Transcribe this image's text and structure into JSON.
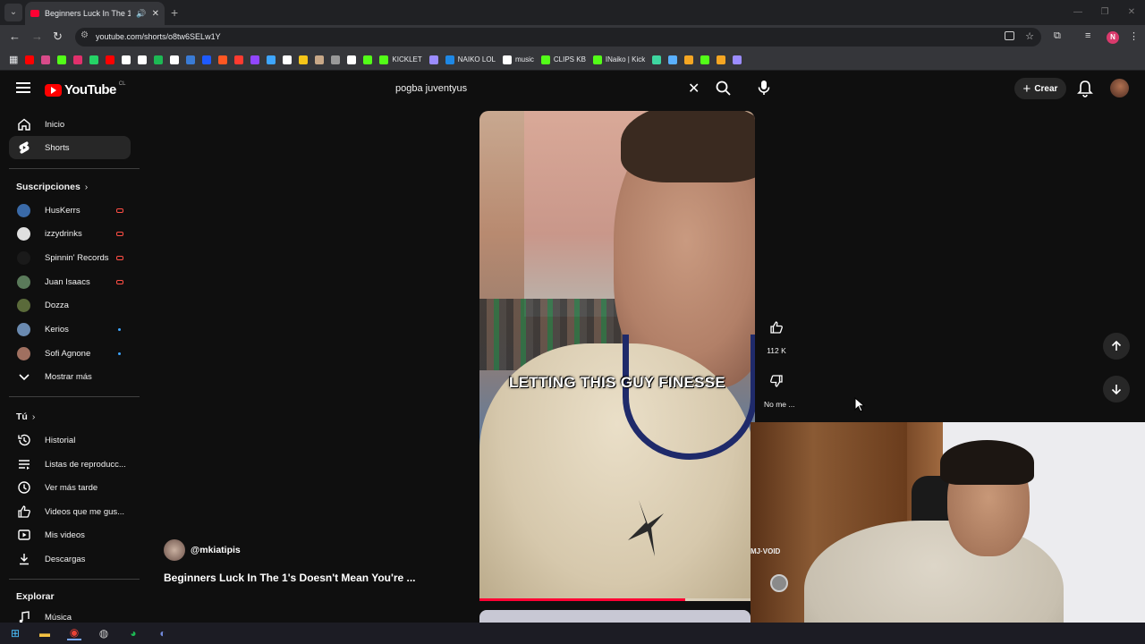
{
  "browser": {
    "tab_title": "Beginners Luck In The 1's Doesn't Mean You're",
    "url": "youtube.com/shorts/o8tw6SELw1Y",
    "profile_initial": "N",
    "bookmarks": [
      {
        "label": "",
        "color": "#ff0000"
      },
      {
        "label": "",
        "color": "#d84b8a"
      },
      {
        "label": "",
        "color": "#53fc18"
      },
      {
        "label": "",
        "color": "#e1306c"
      },
      {
        "label": "",
        "color": "#25d366"
      },
      {
        "label": "",
        "color": "#ff0000"
      },
      {
        "label": "",
        "color": "#ffffff"
      },
      {
        "label": "",
        "color": "#ffffff"
      },
      {
        "label": "",
        "color": "#1db954"
      },
      {
        "label": "",
        "color": "#ffffff"
      },
      {
        "label": "",
        "color": "#3a7bd5"
      },
      {
        "label": "",
        "color": "#1e5aff"
      },
      {
        "label": "",
        "color": "#ff5722"
      },
      {
        "label": "",
        "color": "#ff3b30"
      },
      {
        "label": "",
        "color": "#9146ff"
      },
      {
        "label": "",
        "color": "#3ea6ff"
      },
      {
        "label": "",
        "color": "#ffffff"
      },
      {
        "label": "",
        "color": "#f5c518"
      },
      {
        "label": "",
        "color": "#c8a888"
      },
      {
        "label": "",
        "color": "#999999"
      },
      {
        "label": "",
        "color": "#ffffff"
      },
      {
        "label": "",
        "color": "#53fc18"
      },
      {
        "label": "KICKLET",
        "color": "#53fc18"
      },
      {
        "label": "",
        "color": "#9b8cff"
      },
      {
        "label": "NAIKO LOL",
        "color": "#1e88e5"
      },
      {
        "label": "music",
        "color": "#ffffff"
      },
      {
        "label": "CLIPS KB",
        "color": "#53fc18"
      },
      {
        "label": "INaiko | Kick",
        "color": "#53fc18"
      },
      {
        "label": "",
        "color": "#3ed6a0"
      },
      {
        "label": "",
        "color": "#5ab0ff"
      },
      {
        "label": "",
        "color": "#f5a623"
      },
      {
        "label": "",
        "color": "#53fc18"
      },
      {
        "label": "",
        "color": "#f5a623"
      },
      {
        "label": "",
        "color": "#9b8cff"
      }
    ]
  },
  "youtube": {
    "logo_text": "YouTube",
    "region": "CL",
    "search_query": "pogba juventyus",
    "create_label": "Crear",
    "sidebar": {
      "main": [
        {
          "label": "Inicio",
          "icon": "home-icon"
        },
        {
          "label": "Shorts",
          "icon": "shorts-icon",
          "active": true
        }
      ],
      "subs_header": "Suscripciones",
      "subscriptions": [
        {
          "label": "HusKerrs",
          "status": "live",
          "color": "#3a6aa8"
        },
        {
          "label": "izzydrinks",
          "status": "live",
          "color": "#e0e0e0"
        },
        {
          "label": "Spinnin' Records",
          "status": "live",
          "color": "#1a1a1a"
        },
        {
          "label": "Juan Isaacs",
          "status": "live",
          "color": "#5a7a5a"
        },
        {
          "label": "Dozza",
          "status": "",
          "color": "#5a6a3a"
        },
        {
          "label": "Kerios",
          "status": "new",
          "color": "#6a8ab0"
        },
        {
          "label": "Sofi Agnone",
          "status": "new",
          "color": "#a07060"
        }
      ],
      "show_more": "Mostrar más",
      "you_header": "Tú",
      "you_items": [
        {
          "label": "Historial",
          "icon": "history-icon"
        },
        {
          "label": "Listas de reproducc...",
          "icon": "playlists-icon"
        },
        {
          "label": "Ver más tarde",
          "icon": "watch-later-icon"
        },
        {
          "label": "Videos que me gus...",
          "icon": "liked-videos-icon"
        },
        {
          "label": "Mis videos",
          "icon": "my-videos-icon"
        },
        {
          "label": "Descargas",
          "icon": "downloads-icon"
        }
      ],
      "explore_header": "Explorar",
      "explore_items": [
        {
          "label": "Música",
          "icon": "music-icon"
        }
      ]
    },
    "short": {
      "caption": "LETTING THIS GUY FINESSE",
      "channel": "@mkiatipis",
      "title": "Beginners Luck In The 1's Doesn't Mean You're ...",
      "likes": "112 K",
      "dislike_label": "No me ...",
      "progress": 0.76
    }
  },
  "webcam": {
    "sticker_text": "MJ·VOID"
  },
  "taskbar": [
    {
      "icon": "windows-start-icon"
    },
    {
      "icon": "file-explorer-icon"
    },
    {
      "icon": "chrome-icon",
      "active": true
    },
    {
      "icon": "obs-icon"
    },
    {
      "icon": "spotify-icon"
    },
    {
      "icon": "discord-icon"
    }
  ]
}
